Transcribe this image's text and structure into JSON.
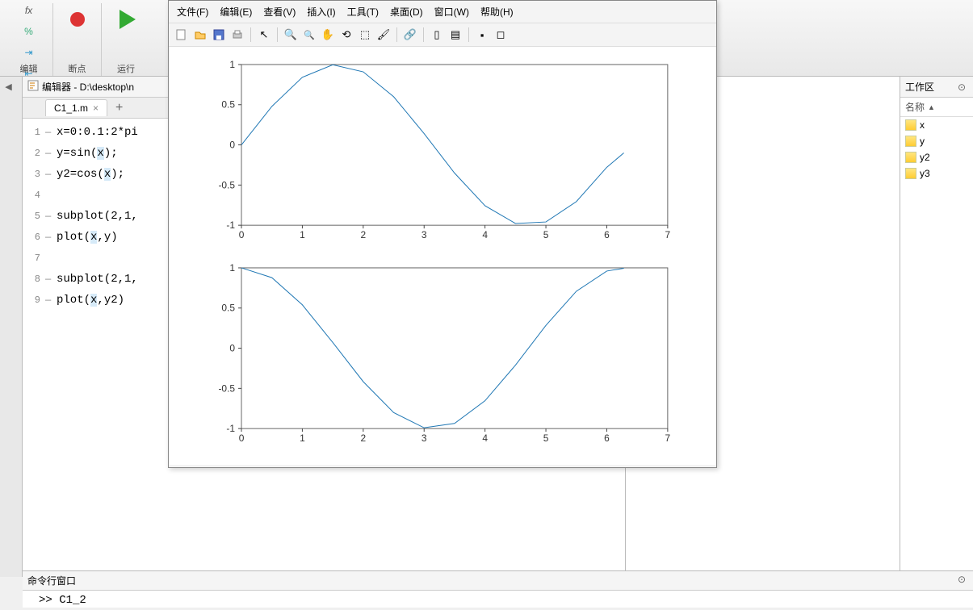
{
  "toolstrip": {
    "groups": [
      "编辑",
      "断点",
      "运行"
    ]
  },
  "editor": {
    "title_prefix": "编辑器 - ",
    "path": "D:\\desktop\\n",
    "tab": "C1_1.m",
    "lines": [
      {
        "n": "1",
        "dash": "—",
        "code": "x=0:0.1:2*pi"
      },
      {
        "n": "2",
        "dash": "—",
        "code": "y=sin(x);"
      },
      {
        "n": "3",
        "dash": "—",
        "code": "y2=cos(x);"
      },
      {
        "n": "4",
        "dash": "",
        "code": ""
      },
      {
        "n": "5",
        "dash": "—",
        "code": "subplot(2,1,"
      },
      {
        "n": "6",
        "dash": "—",
        "code": "plot(x,y)"
      },
      {
        "n": "7",
        "dash": "",
        "code": ""
      },
      {
        "n": "8",
        "dash": "—",
        "code": "subplot(2,1,"
      },
      {
        "n": "9",
        "dash": "—",
        "code": "plot(x,y2)"
      }
    ]
  },
  "workspace": {
    "title": "工作区",
    "header": "名称",
    "vars": [
      "x",
      "y",
      "y2",
      "y3"
    ]
  },
  "command": {
    "title": "命令行窗口",
    "prompt": ">> ",
    "text": "C1_2"
  },
  "figure": {
    "menu": [
      "文件(F)",
      "编辑(E)",
      "查看(V)",
      "插入(I)",
      "工具(T)",
      "桌面(D)",
      "窗口(W)",
      "帮助(H)"
    ]
  },
  "chart_data": [
    {
      "type": "line",
      "title": "",
      "xlabel": "",
      "ylabel": "",
      "xlim": [
        0,
        7
      ],
      "ylim": [
        -1,
        1
      ],
      "xticks": [
        0,
        1,
        2,
        3,
        4,
        5,
        6,
        7
      ],
      "yticks": [
        -1,
        -0.5,
        0,
        0.5,
        1
      ],
      "x": [
        0,
        0.5,
        1,
        1.5,
        2,
        2.5,
        3,
        3.5,
        4,
        4.5,
        5,
        5.5,
        6,
        6.28
      ],
      "values": [
        0,
        0.479,
        0.841,
        0.997,
        0.909,
        0.599,
        0.141,
        -0.351,
        -0.757,
        -0.978,
        -0.959,
        -0.706,
        -0.279,
        -0.1
      ]
    },
    {
      "type": "line",
      "title": "",
      "xlabel": "",
      "ylabel": "",
      "xlim": [
        0,
        7
      ],
      "ylim": [
        -1,
        1
      ],
      "xticks": [
        0,
        1,
        2,
        3,
        4,
        5,
        6,
        7
      ],
      "yticks": [
        -1,
        -0.5,
        0,
        0.5,
        1
      ],
      "x": [
        0,
        0.5,
        1,
        1.5,
        2,
        2.5,
        3,
        3.5,
        4,
        4.5,
        5,
        5.5,
        6,
        6.28
      ],
      "values": [
        1,
        0.878,
        0.54,
        0.071,
        -0.416,
        -0.801,
        -0.99,
        -0.936,
        -0.654,
        -0.211,
        0.284,
        0.709,
        0.96,
        0.995
      ]
    }
  ]
}
